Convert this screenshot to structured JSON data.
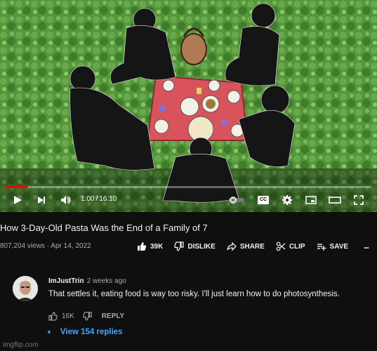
{
  "player": {
    "current_time": "1:00",
    "separator": "/",
    "duration": "16:10",
    "progress_fraction": 0.062,
    "cc_label": "CC",
    "icons": [
      "play-icon",
      "next-icon",
      "volume-icon",
      "autoplay-toggle-icon",
      "captions-icon",
      "settings-icon",
      "miniplayer-icon",
      "theater-icon",
      "fullscreen-icon"
    ]
  },
  "video": {
    "title": "How 3-Day-Old Pasta Was the End of a Family of 7",
    "views": "807,204 views",
    "dot": "·",
    "date": "Apr 14, 2022"
  },
  "actions": {
    "like_count": "39K",
    "dislike_label": "DISLIKE",
    "share_label": "SHARE",
    "clip_label": "CLIP",
    "save_label": "SAVE",
    "more_label": "..."
  },
  "comment": {
    "author": "ImJustTrin",
    "time": "2 weeks ago",
    "text": "That settles it, eating food is way too risky. I'll just learn how to do photosynthesis.",
    "like_count": "16K",
    "reply_label": "REPLY",
    "view_replies": "View 154 replies",
    "caret": "▼"
  },
  "watermark": "imgflip.com",
  "colors": {
    "background": "#0f0f0f",
    "grass": "#4f8f32",
    "blanket": "#d9535c",
    "progress": "#ff0000",
    "link": "#3ea6ff"
  }
}
